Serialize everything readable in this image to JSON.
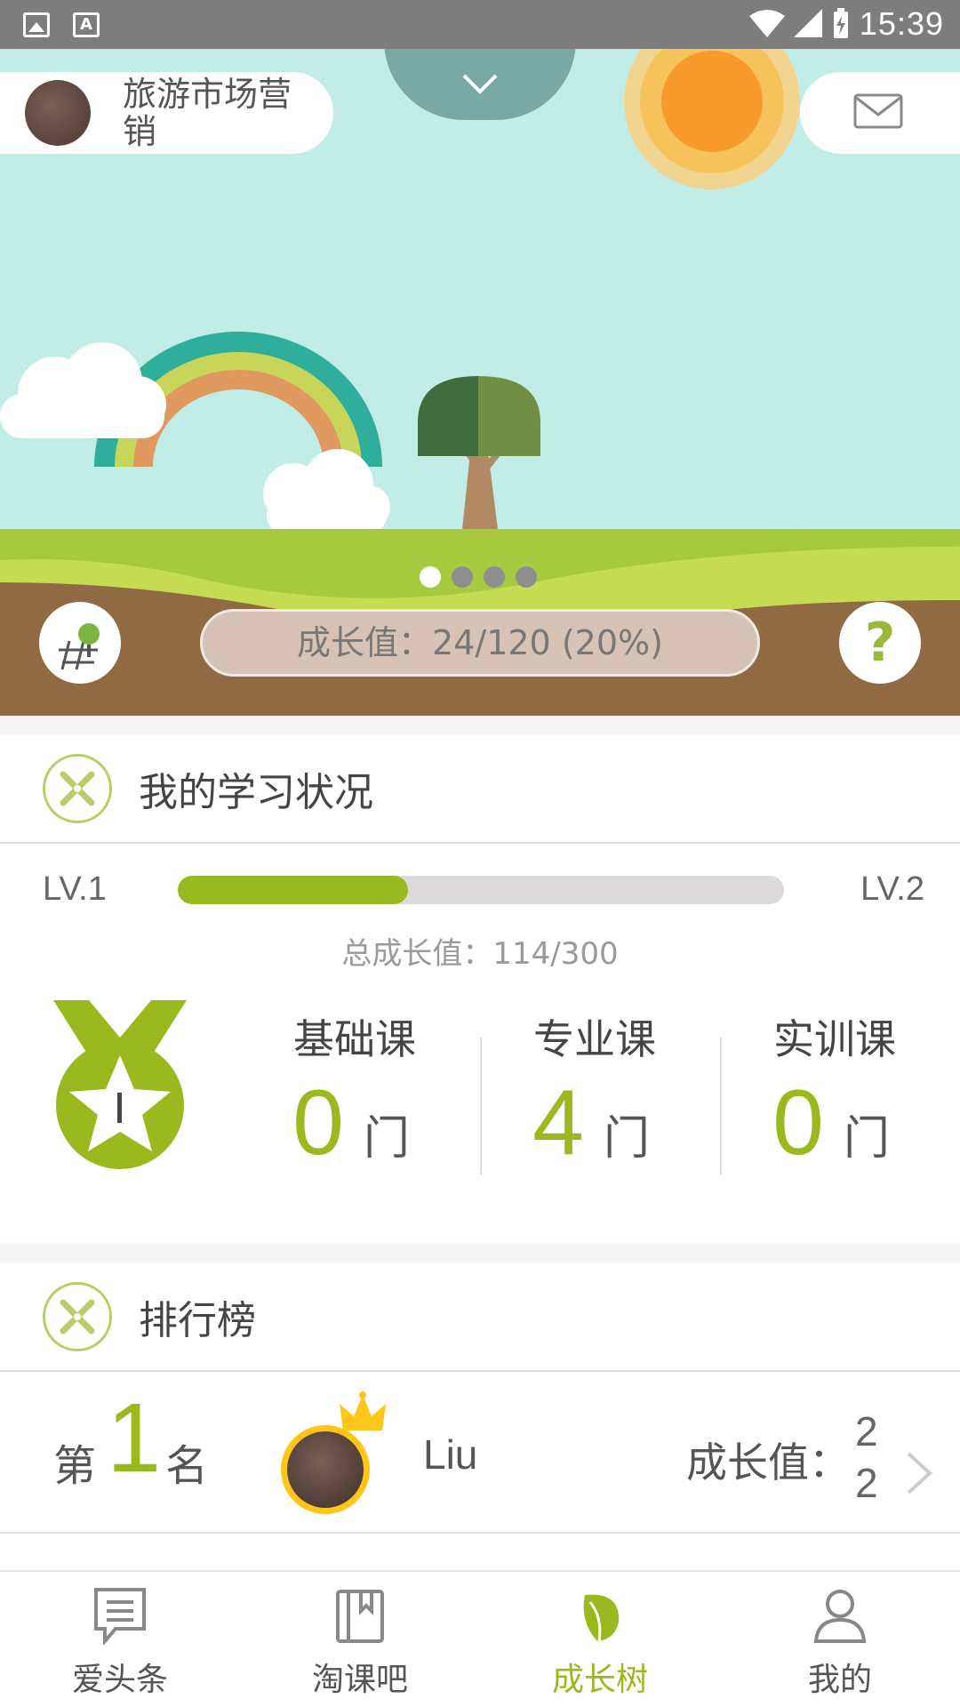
{
  "status_bar": {
    "time": "15:39"
  },
  "header": {
    "user_name": "旅游市场营销"
  },
  "hero": {
    "growth_text": "成长值：24/120 (20%)",
    "help_label": "?",
    "carousel_pages": 4,
    "carousel_active": 0
  },
  "study": {
    "title": "我的学习状况",
    "level_current": "LV.1",
    "level_next": "LV.2",
    "progress_fraction": 0.38,
    "total_growth": "总成长值：114/300",
    "courses": [
      {
        "label": "基础课",
        "count": "0",
        "unit": "门"
      },
      {
        "label": "专业课",
        "count": "4",
        "unit": "门"
      },
      {
        "label": "实训课",
        "count": "0",
        "unit": "门"
      }
    ]
  },
  "ranking": {
    "title": "排行榜",
    "rows": [
      {
        "prefix": "第",
        "rank": "1",
        "suffix": "名",
        "name": "Liu",
        "score_label": "成长值：",
        "score": "22"
      }
    ]
  },
  "tabs": [
    {
      "label": "爱头条",
      "icon": "news-icon"
    },
    {
      "label": "淘课吧",
      "icon": "book-icon"
    },
    {
      "label": "成长树",
      "icon": "leaf-icon"
    },
    {
      "label": "我的",
      "icon": "person-icon"
    }
  ],
  "colors": {
    "accent": "#9ab91e",
    "sky": "#c2ede6",
    "ground": "#8f6a43",
    "grass": "#c5dc52"
  }
}
